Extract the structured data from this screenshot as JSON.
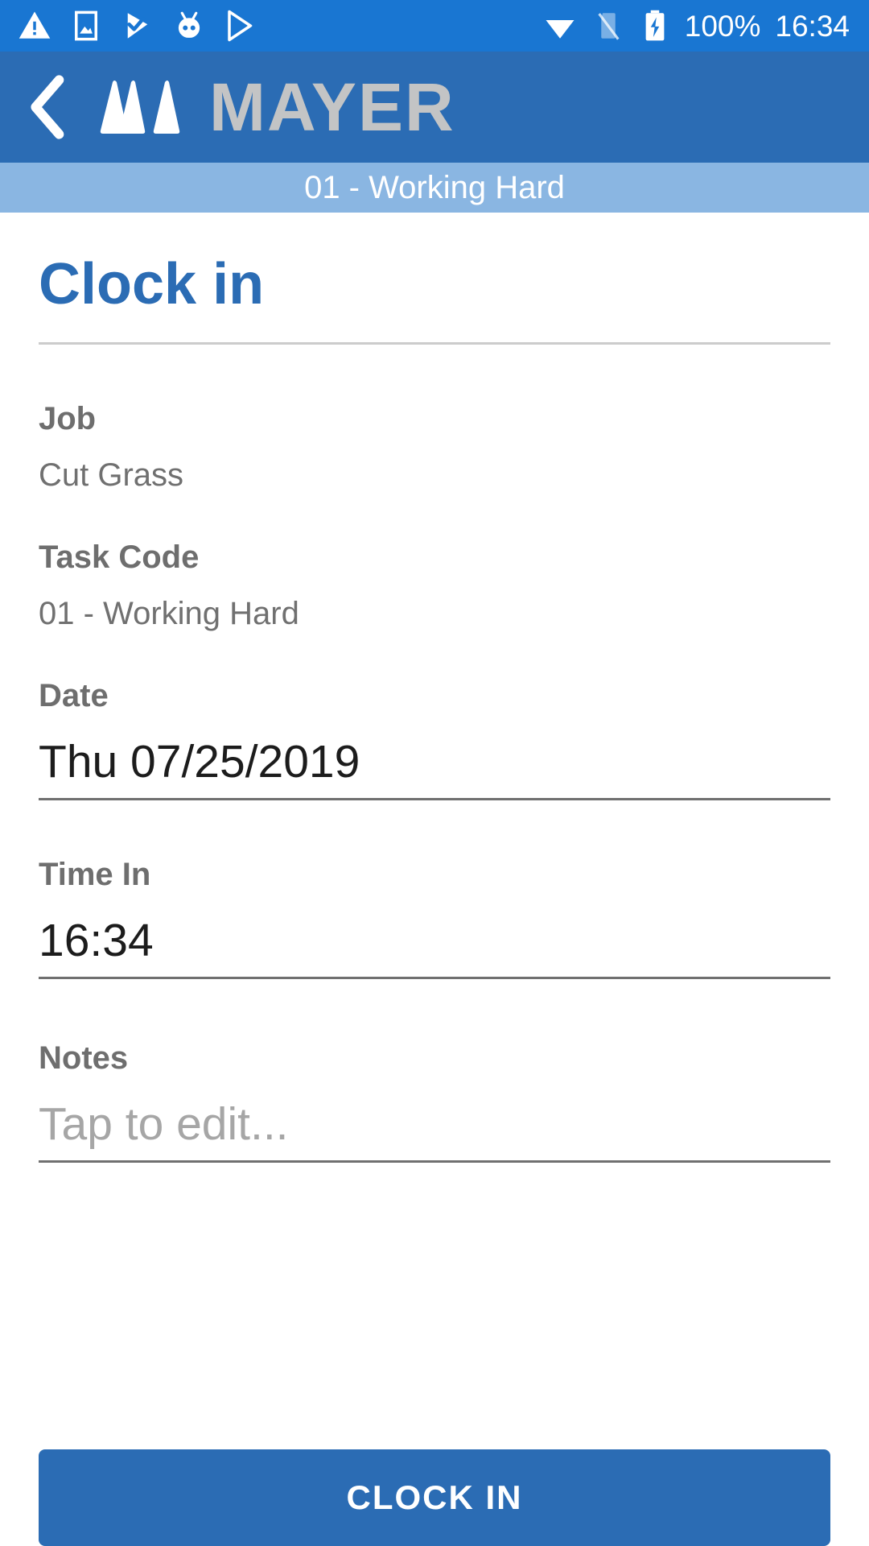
{
  "status_bar": {
    "icons_left": [
      "warning-triangle-icon",
      "screenshot-image-icon",
      "check-play-icon",
      "cyanogenmod-robot-icon",
      "play-store-icon"
    ],
    "icons_right": [
      "wifi-icon",
      "no-sim-card-icon",
      "battery-charging-icon"
    ],
    "battery_label": "100%",
    "clock": "16:34"
  },
  "app_bar": {
    "back_label": "‹",
    "brand_text": "MAYER",
    "brand_mark": "mayer-logo-icon"
  },
  "sub_bar": {
    "text": "01 - Working Hard"
  },
  "page": {
    "title": "Clock in"
  },
  "fields": {
    "job": {
      "label": "Job",
      "value": "Cut Grass"
    },
    "task_code": {
      "label": "Task Code",
      "value": "01 - Working Hard"
    },
    "date": {
      "label": "Date",
      "value": "Thu 07/25/2019"
    },
    "time_in": {
      "label": "Time In",
      "value": "16:34"
    },
    "notes": {
      "label": "Notes",
      "placeholder": "Tap to edit..."
    }
  },
  "actions": {
    "clock_in_label": "CLOCK IN"
  },
  "colors": {
    "status_bar": "#1976d2",
    "app_bar": "#2b6cb4",
    "sub_bar": "#8ab6e2",
    "accent": "#2b6cb4",
    "brand_text": "#c3c4c5",
    "label_gray": "#6e6e6e",
    "value_gray": "#707070",
    "placeholder_gray": "#a6a6a6",
    "divider": "#cccccc",
    "underline": "#707070"
  }
}
